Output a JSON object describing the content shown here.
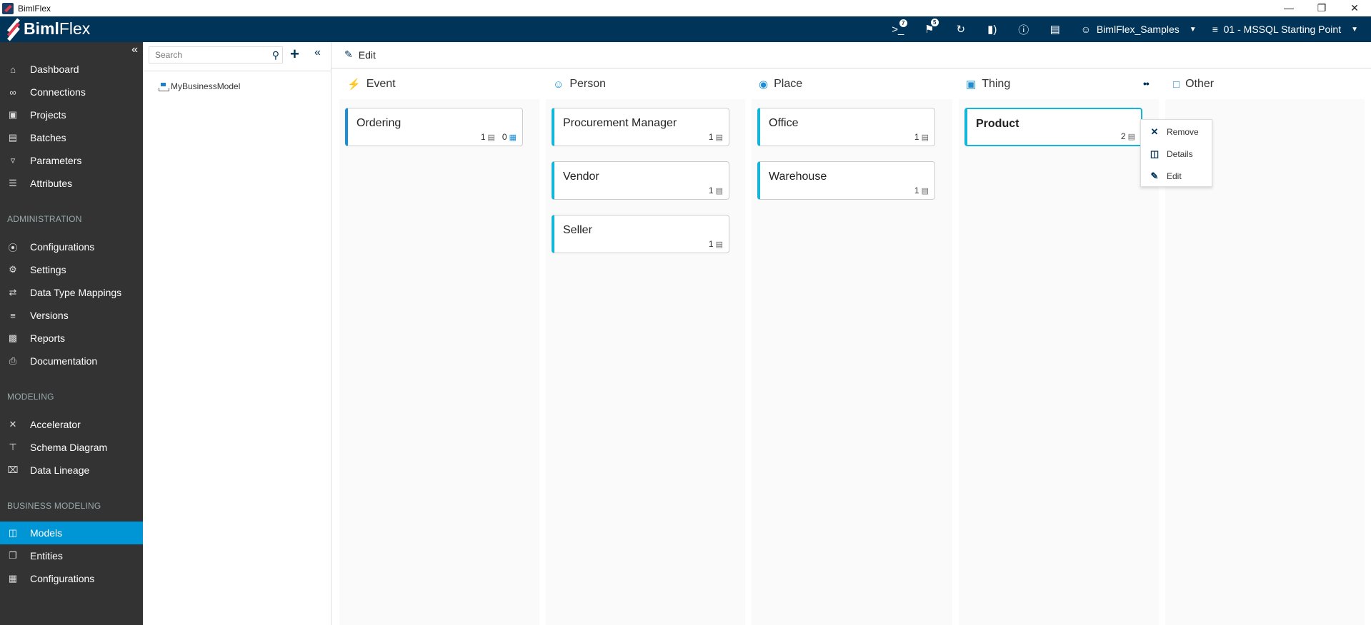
{
  "window": {
    "title": "BimlFlex",
    "controls": [
      "minimize",
      "restore",
      "close"
    ]
  },
  "appbar": {
    "logo_bold": "Biml",
    "logo_light": "Flex",
    "icons": [
      {
        "name": "console-icon",
        "badge": "7"
      },
      {
        "name": "flag-icon",
        "badge": "5"
      },
      {
        "name": "refresh-icon",
        "badge": null
      },
      {
        "name": "build-icon",
        "badge": null
      },
      {
        "name": "help-icon",
        "badge": null
      },
      {
        "name": "server-icon",
        "badge": null
      }
    ],
    "customer": "BimlFlex_Samples",
    "version": "01 - MSSQL Starting Point"
  },
  "sidebar": {
    "items": [
      {
        "label": "Dashboard",
        "icon": "home-icon"
      },
      {
        "label": "Connections",
        "icon": "link-icon"
      },
      {
        "label": "Projects",
        "icon": "projects-icon"
      },
      {
        "label": "Batches",
        "icon": "batches-icon"
      },
      {
        "label": "Parameters",
        "icon": "parameters-icon"
      },
      {
        "label": "Attributes",
        "icon": "attributes-icon"
      }
    ],
    "administration_header": "ADMINISTRATION",
    "administration": [
      {
        "label": "Configurations",
        "icon": "configurations-icon"
      },
      {
        "label": "Settings",
        "icon": "settings-icon"
      },
      {
        "label": "Data Type Mappings",
        "icon": "shuffle-icon"
      },
      {
        "label": "Versions",
        "icon": "layers-icon"
      },
      {
        "label": "Reports",
        "icon": "bar-chart-icon"
      },
      {
        "label": "Documentation",
        "icon": "printer-icon"
      }
    ],
    "modeling_header": "MODELING",
    "modeling": [
      {
        "label": "Accelerator",
        "icon": "accelerator-icon"
      },
      {
        "label": "Schema Diagram",
        "icon": "schema-icon"
      },
      {
        "label": "Data Lineage",
        "icon": "lineage-icon"
      }
    ],
    "business_header": "BUSINESS MODELING",
    "business": [
      {
        "label": "Models",
        "icon": "models-icon",
        "active": true
      },
      {
        "label": "Entities",
        "icon": "entities-icon"
      },
      {
        "label": "Configurations",
        "icon": "configurations-icon"
      }
    ]
  },
  "tree": {
    "search_placeholder": "Search",
    "search_value": "",
    "nodes": [
      "MyBusinessModel"
    ]
  },
  "toolbar": {
    "edit_label": "Edit"
  },
  "columns": [
    {
      "title": "Event",
      "icon": "event-icon",
      "cards": [
        {
          "name": "Ordering",
          "count": "1",
          "extra": "0"
        }
      ]
    },
    {
      "title": "Person",
      "icon": "person-icon",
      "cards": [
        {
          "name": "Procurement Manager",
          "count": "1"
        },
        {
          "name": "Vendor",
          "count": "1"
        },
        {
          "name": "Seller",
          "count": "1"
        }
      ]
    },
    {
      "title": "Place",
      "icon": "place-icon",
      "cards": [
        {
          "name": "Office",
          "count": "1"
        },
        {
          "name": "Warehouse",
          "count": "1"
        }
      ]
    },
    {
      "title": "Thing",
      "icon": "thing-icon",
      "cards": [
        {
          "name": "Product",
          "count": "2",
          "selected": true
        }
      ]
    },
    {
      "title": "Other",
      "icon": "chat-icon",
      "cards": []
    }
  ],
  "context_menu": {
    "items": [
      {
        "label": "Remove",
        "icon": "close-icon"
      },
      {
        "label": "Details",
        "icon": "details-icon"
      },
      {
        "label": "Edit",
        "icon": "pencil-icon"
      }
    ]
  },
  "colors": {
    "appbar": "#003459",
    "sidebar": "#333333",
    "active": "#0096d6",
    "card_accent": "#13b5d8"
  }
}
